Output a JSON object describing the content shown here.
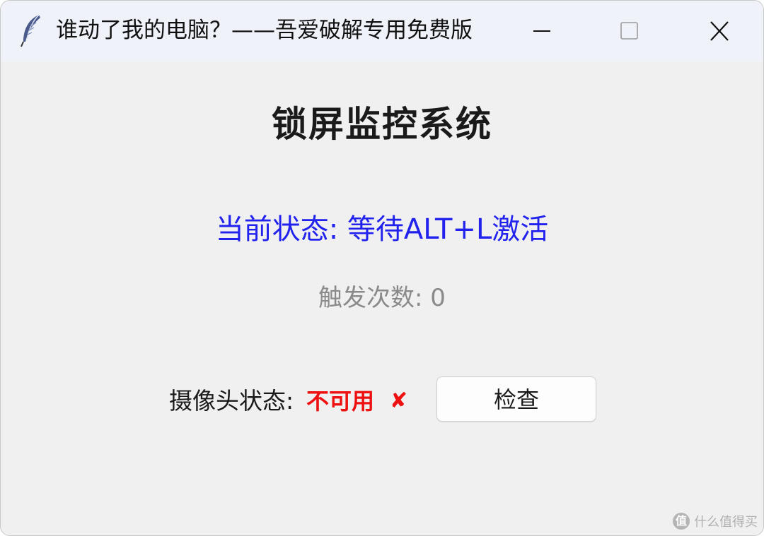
{
  "window": {
    "title": "谁动了我的电脑？——吾爱破解专用免费版",
    "icon": "tk-feather-icon",
    "controls": [
      "minimize-icon",
      "maximize-icon",
      "close-icon"
    ]
  },
  "main": {
    "heading": "锁屏监控系统",
    "status_text": "当前状态: 等待ALT+L激活",
    "trigger_text": "触发次数: 0",
    "camera": {
      "label": "摄像头状态:",
      "value": "不可用",
      "mark": "✘",
      "check_button_label": "检查"
    }
  },
  "watermark": {
    "logo_text": "值",
    "text": "什么值得买"
  },
  "colors": {
    "status": "#2222ee",
    "trigger": "#8a8a8a",
    "camera_unavailable": "#ee1111",
    "window_bg": "#f0f0f0",
    "titlebar_bg": "#eff3f9"
  }
}
